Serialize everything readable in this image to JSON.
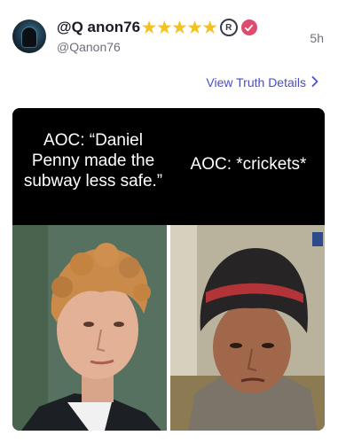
{
  "post": {
    "display_name": "@Q anon76",
    "badge_stars": 5,
    "registered_mark": "R",
    "handle": "@Qanon76",
    "timestamp": "5h",
    "view_details_label": "View Truth Details"
  },
  "meme": {
    "left_caption": "AOC: “Daniel Penny made the subway less safe.”",
    "right_caption": "AOC: *crickets*"
  },
  "colors": {
    "accent_link": "#4a4fbf",
    "star": "#f4c21d",
    "verified_badge": "#e04a6d"
  }
}
